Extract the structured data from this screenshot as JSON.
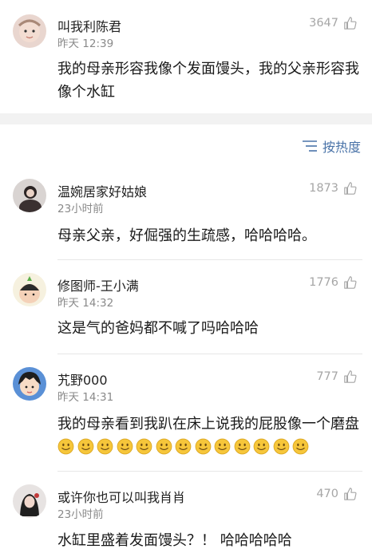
{
  "post": {
    "author": "叫我利陈君",
    "time": "昨天 12:39",
    "likes": "3647",
    "text": "我的母亲形容我像个发面馒头，我的父亲形容我像个水缸"
  },
  "sort": {
    "label": "按热度",
    "icon": "sort-lines-icon"
  },
  "comments": [
    {
      "author": "温婉居家好姑娘",
      "time": "23小时前",
      "likes": "1873",
      "text": "母亲父亲，好倔强的生疏感，哈哈哈哈。"
    },
    {
      "author": "修图师-王小满",
      "time": "昨天 14:32",
      "likes": "1776",
      "text": "这是气的爸妈都不喊了吗哈哈哈"
    },
    {
      "author": "艽野000",
      "time": "昨天 14:31",
      "likes": "777",
      "text": "我的母亲看到我趴在床上说我的屁股像一个磨盘",
      "emoji_count": 13,
      "emoji": "smile-emoji"
    },
    {
      "author": "或许你也可以叫我肖肖",
      "time": "23小时前",
      "likes": "470",
      "text": "水缸里盛着发面馒头？！ 哈哈哈哈哈"
    }
  ],
  "colors": {
    "link": "#4a73a8",
    "meta": "#8a8a8a",
    "like": "#a6a6a6",
    "emoji": "#f6c63a",
    "separator": "#f2f2f2"
  }
}
